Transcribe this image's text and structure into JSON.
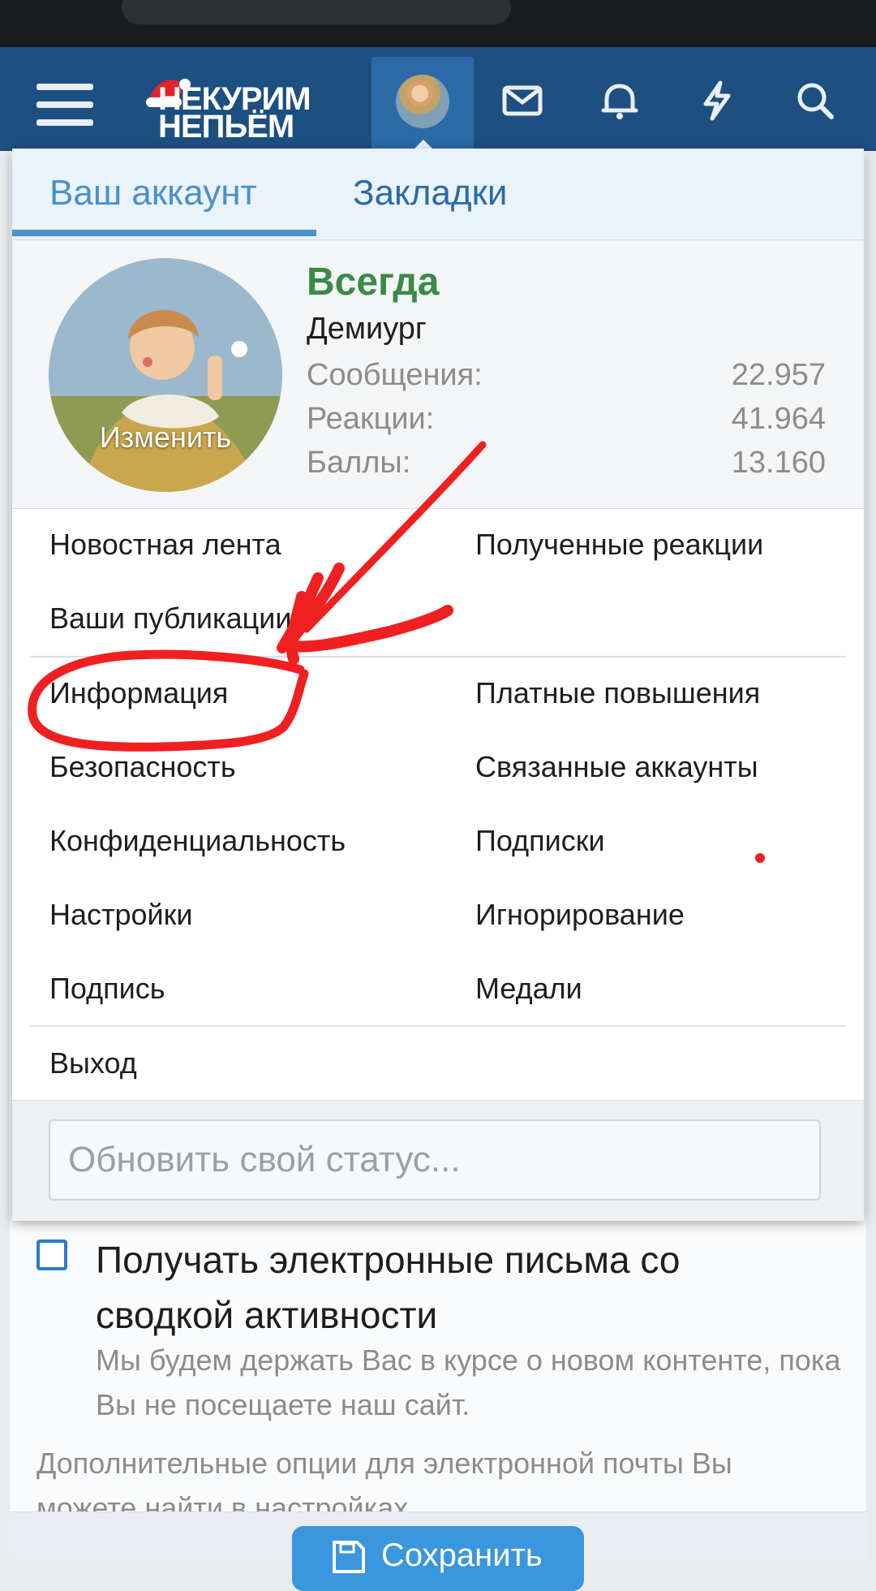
{
  "header": {
    "logo_line1": "НЕКУРИМ",
    "logo_line2": "НЕПЬЁМ"
  },
  "tabs": {
    "account": "Ваш аккаунт",
    "bookmarks": "Закладки"
  },
  "profile": {
    "avatar_edit": "Изменить",
    "username": "Всегда",
    "user_title": "Демиург",
    "stats": [
      {
        "label": "Сообщения:",
        "value": "22.957"
      },
      {
        "label": "Реакции:",
        "value": "41.964"
      },
      {
        "label": "Баллы:",
        "value": "13.160"
      }
    ]
  },
  "menu": {
    "group1": [
      {
        "label": "Новостная лента"
      },
      {
        "label": "Полученные реакции"
      },
      {
        "label": "Ваши публикации"
      }
    ],
    "group2": [
      {
        "label": "Информация"
      },
      {
        "label": "Платные повышения"
      },
      {
        "label": "Безопасность"
      },
      {
        "label": "Связанные аккаунты"
      },
      {
        "label": "Конфиденциальность"
      },
      {
        "label": "Подписки"
      },
      {
        "label": "Настройки"
      },
      {
        "label": "Игнорирование"
      },
      {
        "label": "Подпись"
      },
      {
        "label": "Медали"
      }
    ],
    "logout": "Выход"
  },
  "status": {
    "placeholder": "Обновить свой статус..."
  },
  "form": {
    "checkbox_label": "Получать электронные письма со сводкой активности",
    "checkbox_hint": "Мы будем держать Вас в курсе о новом контенте, пока Вы не посещаете наш сайт.",
    "extra_note": "Дополнительные опции для электронной почты Вы можете найти в настройках.",
    "save_label": "Сохранить"
  },
  "colors": {
    "header_bg": "#1d4f80",
    "accent": "#2b6aa6",
    "username": "#3a8a48",
    "annotation": "#f02020"
  }
}
